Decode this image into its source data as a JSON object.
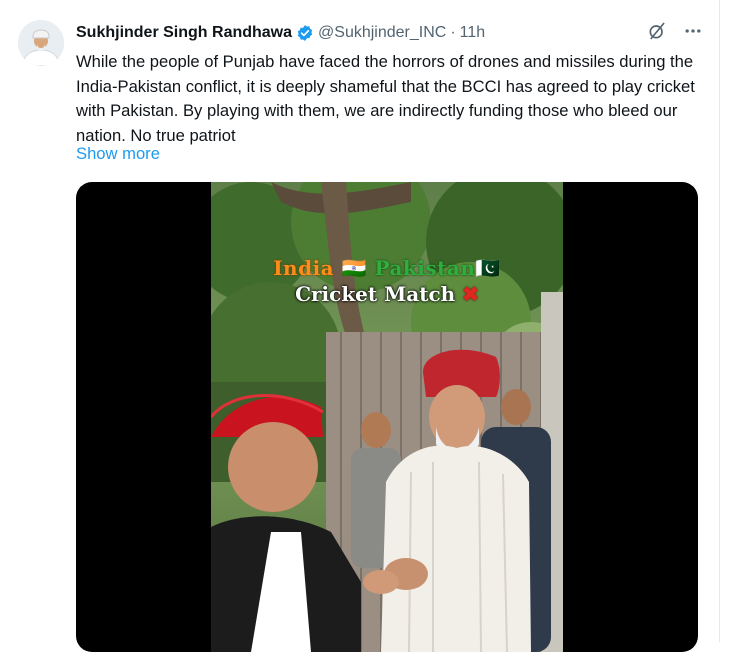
{
  "tweet": {
    "author_name": "Sukhjinder Singh Randhawa",
    "handle": "@Sukhjinder_INC",
    "separator": "·",
    "time": "11h",
    "text": "While the people of Punjab have faced the horrors of drones and missiles during the India-Pakistan conflict, it is deeply shameful that the BCCI has agreed to play cricket with Pakistan. By playing with them, we are indirectly funding those who bleed our nation. No true patriot",
    "show_more": "Show more",
    "accent_color": "#1d9bf0"
  },
  "media": {
    "overlay_line1_a": "India ",
    "overlay_flag_a": "🇮🇳",
    "overlay_line1_b": " Pakistan",
    "overlay_flag_b": "🇵🇰",
    "overlay_line2": "Cricket Match",
    "overlay_x": "✖"
  },
  "icons": {
    "verified": "verified-badge-icon",
    "grok": "grok-slash-icon",
    "more": "more-options-icon"
  }
}
